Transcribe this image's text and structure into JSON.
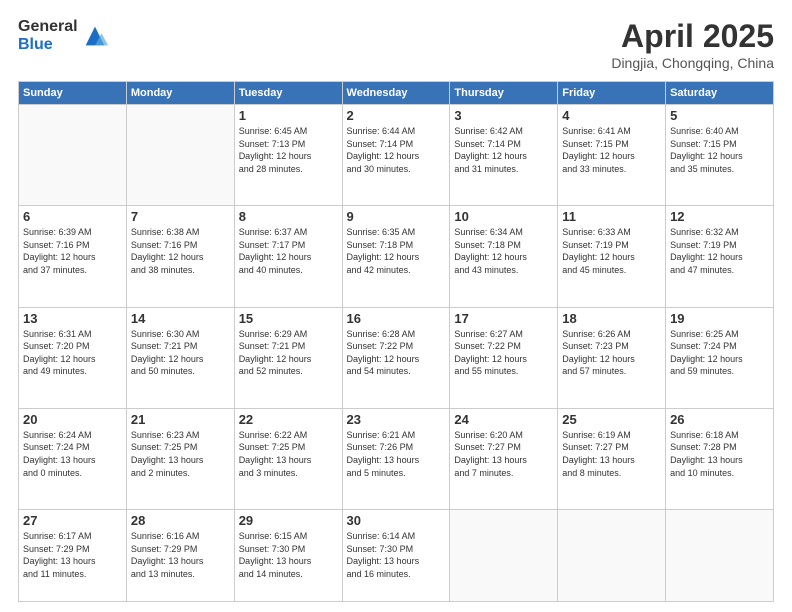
{
  "header": {
    "logo_line1": "General",
    "logo_line2": "Blue",
    "title": "April 2025",
    "location": "Dingjia, Chongqing, China"
  },
  "weekdays": [
    "Sunday",
    "Monday",
    "Tuesday",
    "Wednesday",
    "Thursday",
    "Friday",
    "Saturday"
  ],
  "weeks": [
    [
      {
        "day": "",
        "info": ""
      },
      {
        "day": "",
        "info": ""
      },
      {
        "day": "1",
        "info": "Sunrise: 6:45 AM\nSunset: 7:13 PM\nDaylight: 12 hours\nand 28 minutes."
      },
      {
        "day": "2",
        "info": "Sunrise: 6:44 AM\nSunset: 7:14 PM\nDaylight: 12 hours\nand 30 minutes."
      },
      {
        "day": "3",
        "info": "Sunrise: 6:42 AM\nSunset: 7:14 PM\nDaylight: 12 hours\nand 31 minutes."
      },
      {
        "day": "4",
        "info": "Sunrise: 6:41 AM\nSunset: 7:15 PM\nDaylight: 12 hours\nand 33 minutes."
      },
      {
        "day": "5",
        "info": "Sunrise: 6:40 AM\nSunset: 7:15 PM\nDaylight: 12 hours\nand 35 minutes."
      }
    ],
    [
      {
        "day": "6",
        "info": "Sunrise: 6:39 AM\nSunset: 7:16 PM\nDaylight: 12 hours\nand 37 minutes."
      },
      {
        "day": "7",
        "info": "Sunrise: 6:38 AM\nSunset: 7:16 PM\nDaylight: 12 hours\nand 38 minutes."
      },
      {
        "day": "8",
        "info": "Sunrise: 6:37 AM\nSunset: 7:17 PM\nDaylight: 12 hours\nand 40 minutes."
      },
      {
        "day": "9",
        "info": "Sunrise: 6:35 AM\nSunset: 7:18 PM\nDaylight: 12 hours\nand 42 minutes."
      },
      {
        "day": "10",
        "info": "Sunrise: 6:34 AM\nSunset: 7:18 PM\nDaylight: 12 hours\nand 43 minutes."
      },
      {
        "day": "11",
        "info": "Sunrise: 6:33 AM\nSunset: 7:19 PM\nDaylight: 12 hours\nand 45 minutes."
      },
      {
        "day": "12",
        "info": "Sunrise: 6:32 AM\nSunset: 7:19 PM\nDaylight: 12 hours\nand 47 minutes."
      }
    ],
    [
      {
        "day": "13",
        "info": "Sunrise: 6:31 AM\nSunset: 7:20 PM\nDaylight: 12 hours\nand 49 minutes."
      },
      {
        "day": "14",
        "info": "Sunrise: 6:30 AM\nSunset: 7:21 PM\nDaylight: 12 hours\nand 50 minutes."
      },
      {
        "day": "15",
        "info": "Sunrise: 6:29 AM\nSunset: 7:21 PM\nDaylight: 12 hours\nand 52 minutes."
      },
      {
        "day": "16",
        "info": "Sunrise: 6:28 AM\nSunset: 7:22 PM\nDaylight: 12 hours\nand 54 minutes."
      },
      {
        "day": "17",
        "info": "Sunrise: 6:27 AM\nSunset: 7:22 PM\nDaylight: 12 hours\nand 55 minutes."
      },
      {
        "day": "18",
        "info": "Sunrise: 6:26 AM\nSunset: 7:23 PM\nDaylight: 12 hours\nand 57 minutes."
      },
      {
        "day": "19",
        "info": "Sunrise: 6:25 AM\nSunset: 7:24 PM\nDaylight: 12 hours\nand 59 minutes."
      }
    ],
    [
      {
        "day": "20",
        "info": "Sunrise: 6:24 AM\nSunset: 7:24 PM\nDaylight: 13 hours\nand 0 minutes."
      },
      {
        "day": "21",
        "info": "Sunrise: 6:23 AM\nSunset: 7:25 PM\nDaylight: 13 hours\nand 2 minutes."
      },
      {
        "day": "22",
        "info": "Sunrise: 6:22 AM\nSunset: 7:25 PM\nDaylight: 13 hours\nand 3 minutes."
      },
      {
        "day": "23",
        "info": "Sunrise: 6:21 AM\nSunset: 7:26 PM\nDaylight: 13 hours\nand 5 minutes."
      },
      {
        "day": "24",
        "info": "Sunrise: 6:20 AM\nSunset: 7:27 PM\nDaylight: 13 hours\nand 7 minutes."
      },
      {
        "day": "25",
        "info": "Sunrise: 6:19 AM\nSunset: 7:27 PM\nDaylight: 13 hours\nand 8 minutes."
      },
      {
        "day": "26",
        "info": "Sunrise: 6:18 AM\nSunset: 7:28 PM\nDaylight: 13 hours\nand 10 minutes."
      }
    ],
    [
      {
        "day": "27",
        "info": "Sunrise: 6:17 AM\nSunset: 7:29 PM\nDaylight: 13 hours\nand 11 minutes."
      },
      {
        "day": "28",
        "info": "Sunrise: 6:16 AM\nSunset: 7:29 PM\nDaylight: 13 hours\nand 13 minutes."
      },
      {
        "day": "29",
        "info": "Sunrise: 6:15 AM\nSunset: 7:30 PM\nDaylight: 13 hours\nand 14 minutes."
      },
      {
        "day": "30",
        "info": "Sunrise: 6:14 AM\nSunset: 7:30 PM\nDaylight: 13 hours\nand 16 minutes."
      },
      {
        "day": "",
        "info": ""
      },
      {
        "day": "",
        "info": ""
      },
      {
        "day": "",
        "info": ""
      }
    ]
  ]
}
